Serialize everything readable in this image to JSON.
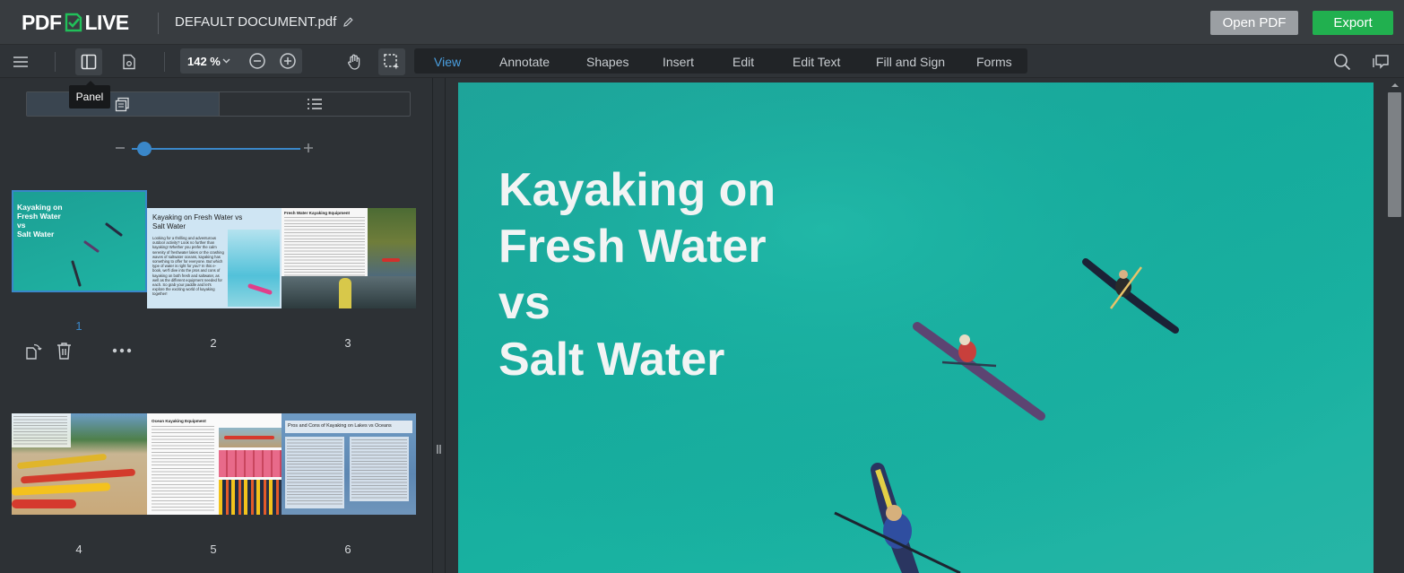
{
  "app": {
    "logo_left": "PDF",
    "logo_right": "LIVE",
    "document_name": "DEFAULT DOCUMENT.pdf"
  },
  "header": {
    "open_label": "Open PDF",
    "export_label": "Export"
  },
  "toolbar": {
    "zoom_value": "142 %",
    "tabs": [
      "View",
      "Annotate",
      "Shapes",
      "Insert",
      "Edit",
      "Edit Text",
      "Fill and Sign",
      "Forms"
    ],
    "active_tab": "View"
  },
  "tooltip": {
    "panel": "Panel"
  },
  "thumbnails": {
    "pages": [
      "1",
      "2",
      "3",
      "4",
      "5",
      "6"
    ],
    "page1_title": [
      "Kayaking on",
      "Fresh Water",
      "vs",
      "Salt Water"
    ],
    "page2_title": "Kayaking on Fresh Water vs Salt Water",
    "page2_body": "Looking for a thrilling and adventurous outdoor activity? Look no further than kayaking! Whether you prefer the calm serenity of freshwater lakes or the crashing waves of saltwater oceans, kayaking has something to offer for everyone. But which type of water is right for you? In this e-book, we'll dive into the pros and cons of kayaking on both fresh and saltwater, as well as the different equipment needed for each. So grab your paddle and let's explore the exciting world of kayaking together!",
    "page3_title": "Fresh Water Kayaking Equipment",
    "page5_title": "Ocean Kayaking Equipment",
    "page6_title": "Pros and Cons of Kayaking on Lakes vs Oceans"
  },
  "document_page": {
    "title_lines": [
      "Kayaking on",
      "Fresh Water",
      "vs",
      "Salt Water"
    ]
  },
  "colors": {
    "accent": "#4a9fe0",
    "export": "#21b04f",
    "water": "#1aae9f"
  }
}
